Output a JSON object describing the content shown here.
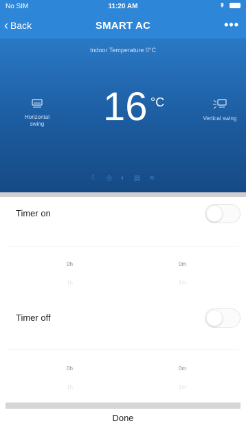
{
  "status_bar": {
    "carrier": "No SIM",
    "time": "11:20 AM"
  },
  "nav": {
    "back_label": "Back",
    "title": "SMART AC",
    "more_label": "•••"
  },
  "hero": {
    "indoor_label": "Indoor Temperature 0°C",
    "temperature": "16",
    "unit": "°C",
    "horizontal_swing_label": "Horizontal\nswing",
    "vertical_swing_label": "Vertical swing"
  },
  "timers": {
    "on": {
      "label": "Timer on",
      "enabled": false,
      "hours_label": "0h",
      "minutes_label": "0m",
      "next_hours": "1h",
      "next_minutes": "1m"
    },
    "off": {
      "label": "Timer off",
      "enabled": false,
      "hours_label": "0h",
      "minutes_label": "0m",
      "next_hours": "1h",
      "next_minutes": "1m"
    }
  },
  "done_label": "Done",
  "colors": {
    "nav_blue": "#2d86d8",
    "panel_blue": "#1c5b9f",
    "text_dark": "#222222"
  }
}
